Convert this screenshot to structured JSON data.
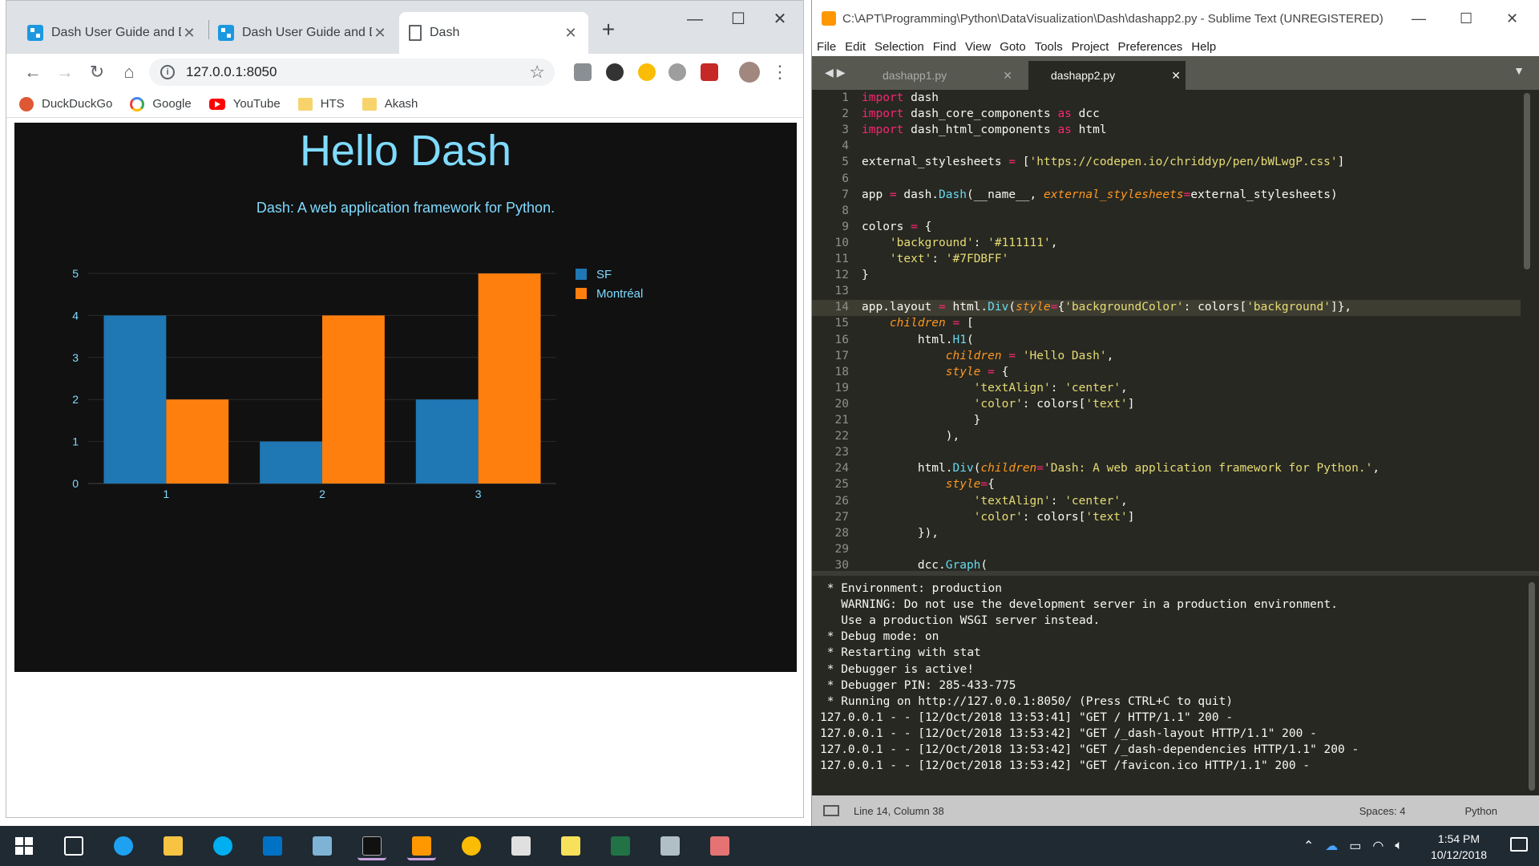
{
  "chrome": {
    "tabs": [
      {
        "title": "Dash User Guide and D",
        "active": false
      },
      {
        "title": "Dash User Guide and D",
        "active": false
      },
      {
        "title": "Dash",
        "active": true
      }
    ],
    "url": "127.0.0.1:8050",
    "bookmarks": [
      {
        "label": "DuckDuckGo",
        "icon": "duckduckgo-icon"
      },
      {
        "label": "Google",
        "icon": "google-icon"
      },
      {
        "label": "YouTube",
        "icon": "youtube-icon"
      },
      {
        "label": "HTS",
        "icon": "folder-icon"
      },
      {
        "label": "Akash",
        "icon": "folder-icon"
      }
    ]
  },
  "dash_app": {
    "title": "Hello Dash",
    "subtitle": "Dash: A web application framework for Python.",
    "background": "#111111",
    "text_color": "#7FDBFF"
  },
  "chart_data": {
    "type": "bar",
    "categories": [
      "1",
      "2",
      "3"
    ],
    "series": [
      {
        "name": "SF",
        "values": [
          4,
          1,
          2
        ],
        "color": "#1f77b4"
      },
      {
        "name": "Montréal",
        "values": [
          2,
          4,
          5
        ],
        "color": "#ff7f0e"
      }
    ],
    "yticks": [
      "0",
      "1",
      "2",
      "3",
      "4",
      "5"
    ],
    "ylim": [
      0,
      5
    ],
    "legend": "top-right",
    "grid": true
  },
  "sublime": {
    "title": "C:\\APT\\Programming\\Python\\DataVisualization\\Dash\\dashapp2.py - Sublime Text (UNREGISTERED)",
    "menu": [
      "File",
      "Edit",
      "Selection",
      "Find",
      "View",
      "Goto",
      "Tools",
      "Project",
      "Preferences",
      "Help"
    ],
    "tabs": [
      {
        "label": "dashapp1.py",
        "active": false
      },
      {
        "label": "dashapp2.py",
        "active": true
      }
    ],
    "highlight_line": 14,
    "code": [
      "<k>import</k> dash",
      "<k>import</k> dash_core_components <k>as</k> dcc",
      "<k>import</k> dash_html_components <k>as</k> html",
      "",
      "external_stylesheets <k>=</k> [<s>'https://codepen.io/chriddyp/pen/bWLwgP.css'</s>]",
      "",
      "app <k>=</k> dash.<f>Dash</f>(__name__, <a>external_stylesheets</a><k>=</k>external_stylesheets)",
      "",
      "colors <k>=</k> {",
      "    <s>'background'</s>: <s>'#111111'</s>,",
      "    <s>'text'</s>: <s>'#7FDBFF'</s>",
      "}",
      "",
      "app.layout <k>=</k> html.<f>Div</f>(<a>style</a><k>=</k>{<s>'backgroundColor'</s>: colors[<s>'background'</s>]},",
      "    <a>children</a> <k>=</k> [",
      "        html.<f>H1</f>(",
      "            <a>children</a> <k>=</k> <s>'Hello Dash'</s>,",
      "            <a>style</a> <k>=</k> {",
      "                <s>'textAlign'</s>: <s>'center'</s>,",
      "                <s>'color'</s>: colors[<s>'text'</s>]",
      "                }",
      "            ),",
      "",
      "        html.<f>Div</f>(<a>children</a><k>=</k><s>'Dash: A web application framework for Python.'</s>,",
      "            <a>style</a><k>=</k>{",
      "                <s>'textAlign'</s>: <s>'center'</s>,",
      "                <s>'color'</s>: colors[<s>'text'</s>]",
      "        }),",
      "",
      "        dcc.<f>Graph</f>("
    ],
    "console": [
      " * Environment: production",
      "   WARNING: Do not use the development server in a production environment.",
      "   Use a production WSGI server instead.",
      " * Debug mode: on",
      " * Restarting with stat",
      " * Debugger is active!",
      " * Debugger PIN: 285-433-775",
      " * Running on http://127.0.0.1:8050/ (Press CTRL+C to quit)",
      "127.0.0.1 - - [12/Oct/2018 13:53:41] \"GET / HTTP/1.1\" 200 -",
      "127.0.0.1 - - [12/Oct/2018 13:53:42] \"GET /_dash-layout HTTP/1.1\" 200 -",
      "127.0.0.1 - - [12/Oct/2018 13:53:42] \"GET /_dash-dependencies HTTP/1.1\" 200 -",
      "127.0.0.1 - - [12/Oct/2018 13:53:42] \"GET /favicon.ico HTTP/1.1\" 200 -"
    ],
    "status_position": "Line 14, Column 38",
    "status_spaces": "Spaces: 4",
    "status_syntax": "Python"
  },
  "taskbar": {
    "time": "1:54 PM",
    "date": "10/12/2018",
    "apps": [
      "start-icon",
      "task-view-icon",
      "internet-explorer-icon",
      "file-explorer-icon",
      "skype-icon",
      "outlook-icon",
      "notepad-icon",
      "command-prompt-icon",
      "sublime-text-icon",
      "chrome-icon",
      "paint-icon",
      "sticky-notes-icon",
      "excel-icon",
      "scanner-icon",
      "paint-3d-icon"
    ]
  }
}
